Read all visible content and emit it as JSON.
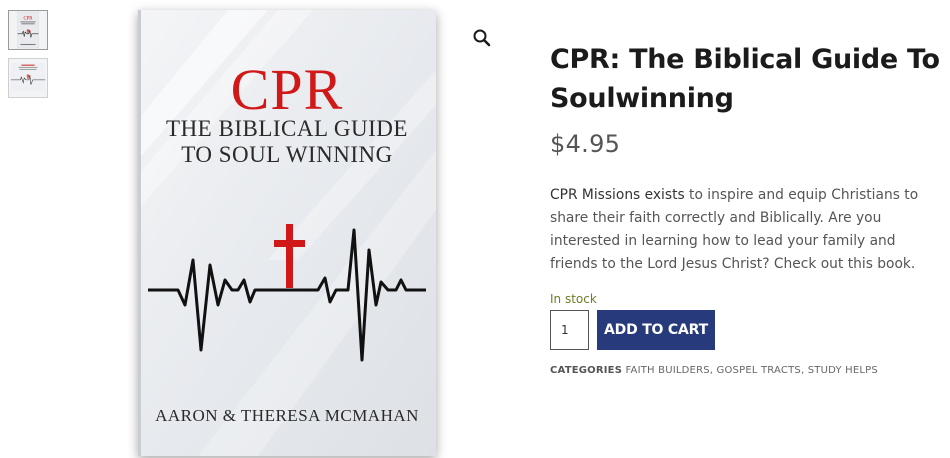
{
  "gallery": {
    "thumbnails": [
      {
        "name": "cover-front"
      },
      {
        "name": "cover-back"
      }
    ],
    "cover": {
      "title_main": "CPR",
      "title_line1": "THE BIBLICAL GUIDE",
      "title_line2": "TO SOUL WINNING",
      "authors": "AARON & THERESA MCMAHAN",
      "accent_color": "#d01818"
    },
    "zoom_icon": "magnifier-icon"
  },
  "product": {
    "title": "CPR: The Biblical Guide To Soulwinning",
    "price": "$4.95",
    "description_brand": "CPR Missions exists",
    "description_rest": " to inspire and equip Christians to share their faith correctly and Biblically. Are you interested in learning how to lead your family and friends to the Lord Jesus Christ? Check out this book.",
    "stock_status": "In stock",
    "quantity": "1",
    "add_to_cart_label": "ADD TO CART",
    "categories_label": "CATEGORIES",
    "categories": [
      "FAITH BUILDERS",
      "GOSPEL TRACTS",
      "STUDY HELPS"
    ],
    "colors": {
      "button": "#263a7c",
      "stock": "#6b7f23"
    }
  }
}
